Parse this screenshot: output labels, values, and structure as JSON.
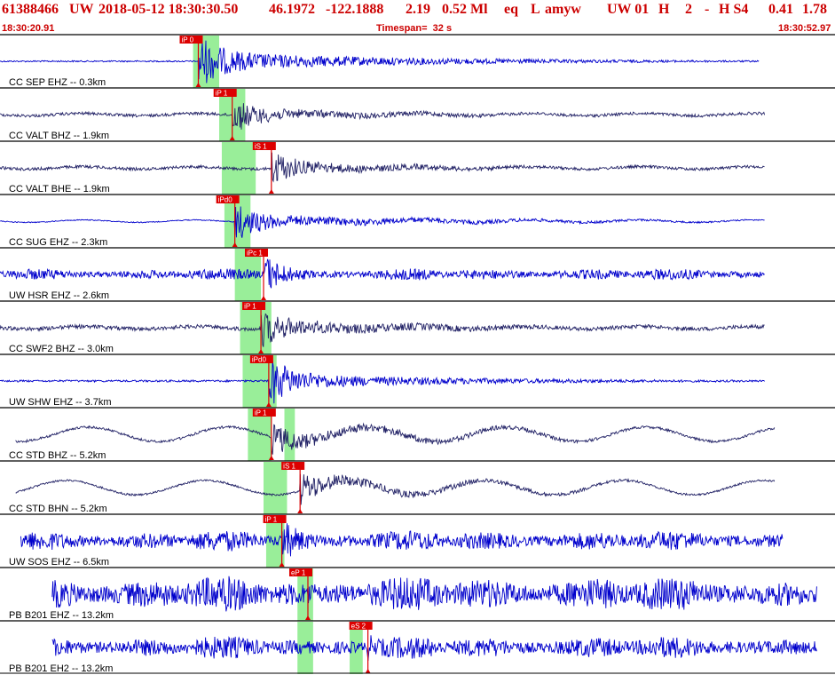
{
  "header": {
    "event_id": "61388466",
    "network": "UW",
    "origin_time": "2018-05-12 18:30:30.50",
    "latitude": "46.1972",
    "longitude": "-122.1888",
    "depth": "2.19",
    "magnitude": "0.52 Ml",
    "event_type": "eq",
    "flag": "L",
    "analyst": "amyw",
    "solution": "UW 01",
    "quality_code": "H",
    "version": "2",
    "dash": "-",
    "quality_code_2": "H S4",
    "rms": "0.41",
    "err": "1.78"
  },
  "subheader": {
    "start_time": "18:30:20.91",
    "timespan": "Timespan=  32 s",
    "end_time": "18:30:52.97"
  },
  "colors": {
    "header_text": "#cc0000",
    "trace_dark": "#1a1a66",
    "trace_blue": "#0000cc",
    "pick_red": "#dd0000",
    "window_green": "#99ee99",
    "separator": "#000000"
  },
  "traces": [
    {
      "label": "CC SEP EHZ -- 0.3km",
      "pick": "iP 0",
      "arrival_s": 7.6,
      "green": [
        [
          7.4,
          8.4
        ]
      ],
      "color": "#0000cc",
      "style": "spike",
      "noise": 0.03,
      "amp": 0.85,
      "coda": 0.38,
      "start": 0.0,
      "end": 29.1
    },
    {
      "label": "CC VALT BHZ -- 1.9km",
      "pick": "iP 1",
      "arrival_s": 8.9,
      "green": [
        [
          8.4,
          9.4
        ]
      ],
      "color": "#222266",
      "style": "coda",
      "noise": 0.06,
      "amp": 0.6,
      "coda": 0.22,
      "start": 0.0,
      "end": 29.3
    },
    {
      "label": "CC VALT BHE -- 1.9km",
      "pick": "iS 1",
      "arrival_s": 10.4,
      "green": [
        [
          8.5,
          9.8
        ]
      ],
      "color": "#222266",
      "style": "coda",
      "noise": 0.06,
      "amp": 0.6,
      "coda": 0.22,
      "start": 0.0,
      "end": 29.3
    },
    {
      "label": "CC SUG EHZ -- 2.3km",
      "pick": "iPd0",
      "arrival_s": 9.0,
      "green": [
        [
          8.6,
          9.6
        ]
      ],
      "color": "#0000cc",
      "style": "coda",
      "noise": 0.02,
      "amp": 0.6,
      "coda": 0.25,
      "start": 0.0,
      "end": 29.3
    },
    {
      "label": "UW HSR EHZ -- 2.6km",
      "pick": "iPc 1",
      "arrival_s": 10.1,
      "green": [
        [
          9.0,
          10.0
        ]
      ],
      "color": "#0000cc",
      "style": "noisy",
      "noise": 0.18,
      "amp": 0.8,
      "coda": 0.12,
      "start": 0.0,
      "end": 29.3
    },
    {
      "label": "CC SWF2 BHZ -- 3.0km",
      "pick": "iP 1",
      "arrival_s": 10.0,
      "green": [
        [
          9.2,
          10.4
        ]
      ],
      "color": "#222266",
      "style": "coda",
      "noise": 0.08,
      "amp": 0.55,
      "coda": 0.3,
      "start": 0.0,
      "end": 29.3
    },
    {
      "label": "UW SHW EHZ -- 3.7km",
      "pick": "iPd0",
      "arrival_s": 10.3,
      "green": [
        [
          9.3,
          10.6
        ]
      ],
      "color": "#0000cc",
      "style": "spike",
      "noise": 0.04,
      "amp": 0.85,
      "coda": 0.3,
      "start": 0.0,
      "end": 29.3
    },
    {
      "label": "CC STD BHZ -- 5.2km",
      "pick": "iP 1",
      "arrival_s": 10.4,
      "green": [
        [
          9.5,
          10.4
        ],
        [
          10.9,
          11.3
        ]
      ],
      "color": "#222266",
      "style": "wavy",
      "noise": 0.05,
      "amp": 0.5,
      "coda": 0.25,
      "start": 0.6,
      "end": 29.7
    },
    {
      "label": "CC STD BHN -- 5.2km",
      "pick": "iS 1",
      "arrival_s": 11.5,
      "green": [
        [
          10.1,
          11.0
        ]
      ],
      "color": "#222266",
      "style": "wavy",
      "noise": 0.04,
      "amp": 0.55,
      "coda": 0.22,
      "start": 0.6,
      "end": 29.7
    },
    {
      "label": "UW SOS EHZ -- 6.5km",
      "pick": "iP 1",
      "arrival_s": 10.8,
      "green": [
        [
          10.2,
          10.9
        ]
      ],
      "color": "#0000cc",
      "style": "noisy",
      "noise": 0.32,
      "amp": 0.8,
      "coda": 0.15,
      "start": 0.8,
      "end": 30.0
    },
    {
      "label": "PB B201 EHZ -- 13.2km",
      "pick": "eP 1",
      "arrival_s": 11.8,
      "green": [
        [
          11.4,
          12.0
        ]
      ],
      "color": "#0000cc",
      "style": "noisy",
      "noise": 0.55,
      "amp": 0.6,
      "coda": 0.0,
      "start": 2.0,
      "end": 31.3
    },
    {
      "label": "PB B201 EH2 -- 13.2km",
      "pick": "eS 2",
      "arrival_s": 14.1,
      "green": [
        [
          11.4,
          12.0
        ],
        [
          13.4,
          13.9
        ]
      ],
      "color": "#0000cc",
      "style": "noisy",
      "noise": 0.35,
      "amp": 0.6,
      "coda": 0.0,
      "start": 2.0,
      "end": 31.3
    }
  ]
}
